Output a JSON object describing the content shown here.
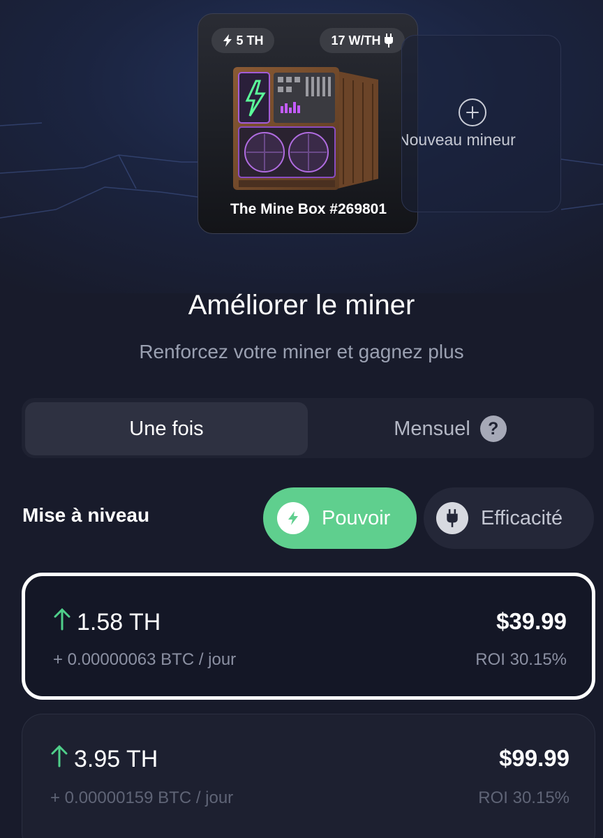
{
  "miner": {
    "power_badge": "5 TH",
    "efficiency_badge": "17 W/TH",
    "name": "The Mine Box #269801",
    "badge_icons": [
      "bolt-icon",
      "plug-icon"
    ]
  },
  "add_miner": {
    "label": "Nouveau mineur",
    "icon": "plus-circle-icon"
  },
  "header": {
    "title": "Améliorer le miner",
    "subtitle": "Renforcez votre miner et gagnez plus"
  },
  "billing_tabs": {
    "items": [
      "Une fois",
      "Mensuel"
    ],
    "selected": "Une fois",
    "help_icon_text": "?"
  },
  "upgrade": {
    "label": "Mise à niveau",
    "options": [
      {
        "label": "Pouvoir",
        "icon": "bolt-icon",
        "selected": true
      },
      {
        "label": "Efficacité",
        "icon": "plug-icon",
        "selected": false
      }
    ]
  },
  "offers": [
    {
      "hashrate": "1.58 TH",
      "price": "$39.99",
      "btc": "+ 0.00000063 BTC / jour",
      "roi": "ROI 30.15%",
      "selected": true
    },
    {
      "hashrate": "3.95 TH",
      "price": "$99.99",
      "btc": "+ 0.00000159 BTC / jour",
      "roi": "ROI 30.15%",
      "selected": false
    }
  ],
  "colors": {
    "background": "#181b2b",
    "accent_green": "#5fcf8e",
    "arrow_green": "#4fcf8a",
    "muted_text": "#9aa0b1"
  }
}
